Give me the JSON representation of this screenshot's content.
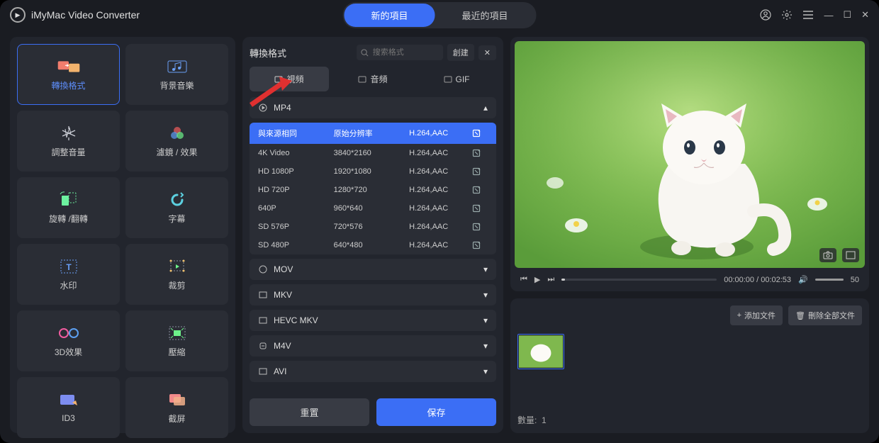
{
  "app_title": "iMyMac Video Converter",
  "top_tabs": {
    "new": "新的項目",
    "recent": "最近的項目"
  },
  "sidebar": [
    {
      "id": "convert",
      "label": "轉換格式",
      "selected": true
    },
    {
      "id": "music",
      "label": "背景音樂"
    },
    {
      "id": "volume",
      "label": "調整音量"
    },
    {
      "id": "filter",
      "label": "濾鏡 / 效果"
    },
    {
      "id": "rotate",
      "label": "旋轉 /翻轉"
    },
    {
      "id": "subtitle",
      "label": "字幕"
    },
    {
      "id": "watermark",
      "label": "水印"
    },
    {
      "id": "crop",
      "label": "裁剪"
    },
    {
      "id": "3d",
      "label": "3D效果"
    },
    {
      "id": "compress",
      "label": "壓縮"
    },
    {
      "id": "id3",
      "label": "ID3"
    },
    {
      "id": "screenshot",
      "label": "截屏"
    }
  ],
  "center": {
    "title": "轉換格式",
    "search_placeholder": "搜索格式",
    "create": "創建",
    "tabs": {
      "video": "視頻",
      "audio": "音頻",
      "gif": "GIF"
    },
    "groups": {
      "mp4": "MP4",
      "mov": "MOV",
      "mkv": "MKV",
      "hevc": "HEVC MKV",
      "m4v": "M4V",
      "avi": "AVI"
    },
    "mp4_rows": [
      {
        "name": "與來源相同",
        "res": "原始分辨率",
        "codec": "H.264,AAC",
        "sel": true
      },
      {
        "name": "4K Video",
        "res": "3840*2160",
        "codec": "H.264,AAC"
      },
      {
        "name": "HD 1080P",
        "res": "1920*1080",
        "codec": "H.264,AAC"
      },
      {
        "name": "HD 720P",
        "res": "1280*720",
        "codec": "H.264,AAC"
      },
      {
        "name": "640P",
        "res": "960*640",
        "codec": "H.264,AAC"
      },
      {
        "name": "SD 576P",
        "res": "720*576",
        "codec": "H.264,AAC"
      },
      {
        "name": "SD 480P",
        "res": "640*480",
        "codec": "H.264,AAC"
      }
    ],
    "reset": "重置",
    "save": "保存"
  },
  "player": {
    "time_current": "00:00:00",
    "time_total": "00:02:53",
    "volume": "50"
  },
  "files": {
    "add": "添加文件",
    "remove": "刪除全部文件",
    "count_label": "數量:",
    "count_value": "1"
  }
}
